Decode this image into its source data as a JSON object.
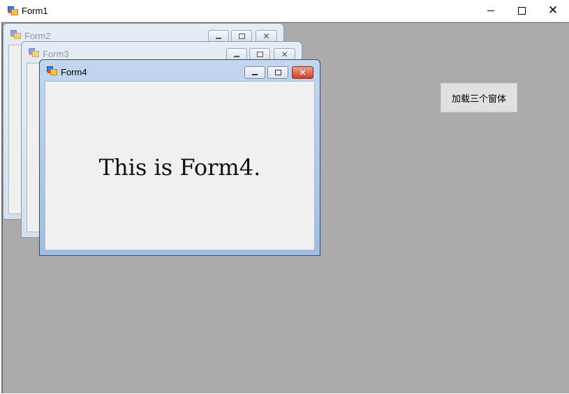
{
  "main_window": {
    "title": "Form1",
    "controls": {
      "minimize": "minimize",
      "maximize": "maximize",
      "close": "close"
    },
    "load_button_label": "加载三个窗体"
  },
  "children": [
    {
      "title": "Form2",
      "state": "inactive"
    },
    {
      "title": "Form3",
      "state": "inactive"
    },
    {
      "title": "Form4",
      "state": "active",
      "content_text": "This is Form4."
    }
  ],
  "colors": {
    "mdi_background": "#ababab",
    "active_close": "#c9452e"
  }
}
